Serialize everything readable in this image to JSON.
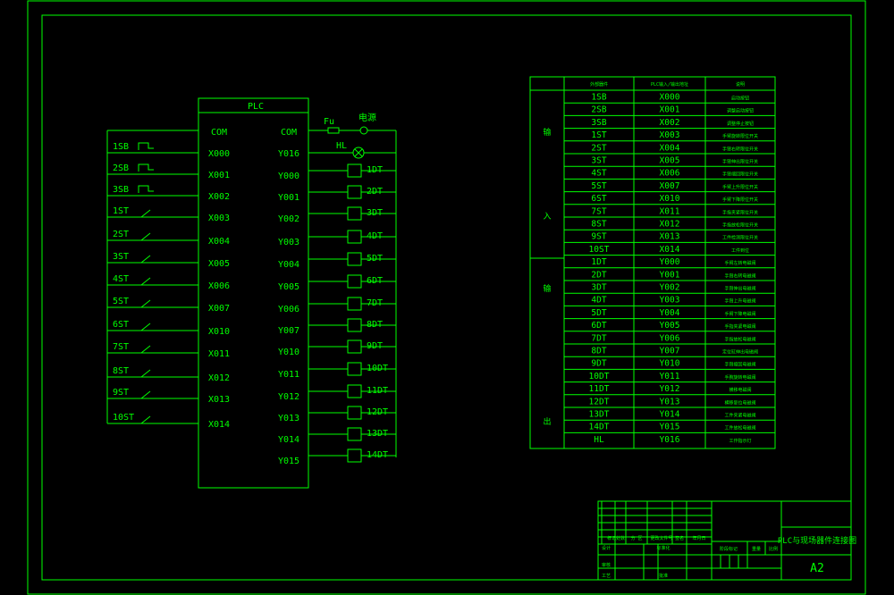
{
  "plc": {
    "title": "PLC",
    "com_left": "COM",
    "com_right": "COM",
    "fuse_label": "Fu",
    "power_label": "电源",
    "lamp_label": "HL",
    "inputs": [
      {
        "device": "1SB",
        "address": "X000",
        "kind": "button"
      },
      {
        "device": "2SB",
        "address": "X001",
        "kind": "button"
      },
      {
        "device": "3SB",
        "address": "X002",
        "kind": "button"
      },
      {
        "device": "1ST",
        "address": "X003",
        "kind": "switch"
      },
      {
        "device": "2ST",
        "address": "X004",
        "kind": "switch"
      },
      {
        "device": "3ST",
        "address": "X005",
        "kind": "switch"
      },
      {
        "device": "4ST",
        "address": "X006",
        "kind": "switch"
      },
      {
        "device": "5ST",
        "address": "X007",
        "kind": "switch"
      },
      {
        "device": "6ST",
        "address": "X010",
        "kind": "switch"
      },
      {
        "device": "7ST",
        "address": "X011",
        "kind": "switch"
      },
      {
        "device": "8ST",
        "address": "X012",
        "kind": "switch"
      },
      {
        "device": "9ST",
        "address": "X013",
        "kind": "switch"
      },
      {
        "device": "10ST",
        "address": "X014",
        "kind": "switch"
      }
    ],
    "lamp_output": "Y016",
    "outputs": [
      {
        "address": "Y000",
        "device": "1DT"
      },
      {
        "address": "Y001",
        "device": "2DT"
      },
      {
        "address": "Y002",
        "device": "3DT"
      },
      {
        "address": "Y003",
        "device": "4DT"
      },
      {
        "address": "Y004",
        "device": "5DT"
      },
      {
        "address": "Y005",
        "device": "6DT"
      },
      {
        "address": "Y006",
        "device": "7DT"
      },
      {
        "address": "Y007",
        "device": "8DT"
      },
      {
        "address": "Y010",
        "device": "9DT"
      },
      {
        "address": "Y011",
        "device": "10DT"
      },
      {
        "address": "Y012",
        "device": "11DT"
      },
      {
        "address": "Y013",
        "device": "12DT"
      },
      {
        "address": "Y014",
        "device": "13DT"
      },
      {
        "address": "Y015",
        "device": "14DT"
      }
    ]
  },
  "io_table": {
    "headers": [
      "外部器件",
      "PLC输入/输出地址",
      "说明"
    ],
    "group_input": [
      "输",
      "入"
    ],
    "group_output": [
      "输",
      "出"
    ],
    "input_rows": [
      [
        "1SB",
        "X000",
        "启动按钮"
      ],
      [
        "2SB",
        "X001",
        "调整启动按钮"
      ],
      [
        "3SB",
        "X002",
        "调整停止按钮"
      ],
      [
        "1ST",
        "X003",
        "手臂旋转限位开关"
      ],
      [
        "2ST",
        "X004",
        "手臂右转限位开关"
      ],
      [
        "3ST",
        "X005",
        "手臂伸出限位开关"
      ],
      [
        "4ST",
        "X006",
        "手臂缩回限位开关"
      ],
      [
        "5ST",
        "X007",
        "手臂上升限位开关"
      ],
      [
        "6ST",
        "X010",
        "手臂下降限位开关"
      ],
      [
        "7ST",
        "X011",
        "手指夹紧限位开关"
      ],
      [
        "8ST",
        "X012",
        "手指放松限位开关"
      ],
      [
        "9ST",
        "X013",
        "工件检测限位开关"
      ],
      [
        "10ST",
        "X014",
        "工件到位"
      ]
    ],
    "output_rows": [
      [
        "1DT",
        "Y000",
        "手臂左转电磁阀"
      ],
      [
        "2DT",
        "Y001",
        "手臂右转电磁阀"
      ],
      [
        "3DT",
        "Y002",
        "手臂伸出电磁阀"
      ],
      [
        "4DT",
        "Y003",
        "手臂上升电磁阀"
      ],
      [
        "5DT",
        "Y004",
        "手臂下降电磁阀"
      ],
      [
        "6DT",
        "Y005",
        "手指夹紧电磁阀"
      ],
      [
        "7DT",
        "Y006",
        "手指放松电磁阀"
      ],
      [
        "8DT",
        "Y007",
        "定位缸伸出电磁阀"
      ],
      [
        "9DT",
        "Y010",
        "手臂缩回电磁阀"
      ],
      [
        "10DT",
        "Y011",
        "手腕旋转电磁阀"
      ],
      [
        "11DT",
        "Y012",
        "横移电磁阀"
      ],
      [
        "12DT",
        "Y013",
        "横移复位电磁阀"
      ],
      [
        "13DT",
        "Y014",
        "工件夹紧电磁阀"
      ],
      [
        "14DT",
        "Y015",
        "工件放松电磁阀"
      ],
      [
        "HL",
        "Y016",
        "工作指示灯"
      ]
    ]
  },
  "title_block": {
    "drawing_title": "PLC与现场器件连接图",
    "size": "A2",
    "labels": [
      "标记",
      "处数",
      "分 区",
      "更改文件号",
      "签名",
      "年月日",
      "设计",
      "标准化",
      "阶段标记",
      "重量",
      "比例",
      "审核",
      "工艺",
      "批准"
    ]
  }
}
